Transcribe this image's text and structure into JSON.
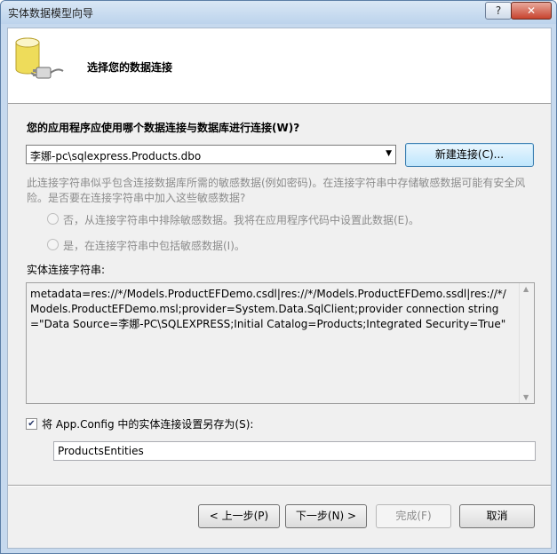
{
  "window": {
    "title": "实体数据模型向导",
    "help_label": "?",
    "close_label": "✕"
  },
  "header": {
    "title": "选择您的数据连接",
    "icon": "database-plug-icon"
  },
  "question": "您的应用程序应使用哪个数据连接与数据库进行连接(W)?",
  "connection": {
    "selected": "李娜-pc\\sqlexpress.Products.dbo",
    "new_button": "新建连接(C)..."
  },
  "sensitive": {
    "description": "此连接字符串似乎包含连接数据库所需的敏感数据(例如密码)。在连接字符串中存储敏感数据可能有安全风险。是否要在连接字符串中加入这些敏感数据?",
    "option_no": "否，从连接字符串中排除敏感数据。我将在应用程序代码中设置此数据(E)。",
    "option_yes": "是，在连接字符串中包括敏感数据(I)。"
  },
  "entity_connection": {
    "label": "实体连接字符串:",
    "value": "metadata=res://*/Models.ProductEFDemo.csdl|res://*/Models.ProductEFDemo.ssdl|res://*/Models.ProductEFDemo.msl;provider=System.Data.SqlClient;provider connection string=\"Data Source=李娜-PC\\SQLEXPRESS;Initial Catalog=Products;Integrated Security=True\""
  },
  "save": {
    "checked": true,
    "label": "将 App.Config 中的实体连接设置另存为(S):",
    "value": "ProductsEntities"
  },
  "buttons": {
    "back": "< 上一步(P)",
    "next": "下一步(N) >",
    "finish": "完成(F)",
    "cancel": "取消"
  }
}
